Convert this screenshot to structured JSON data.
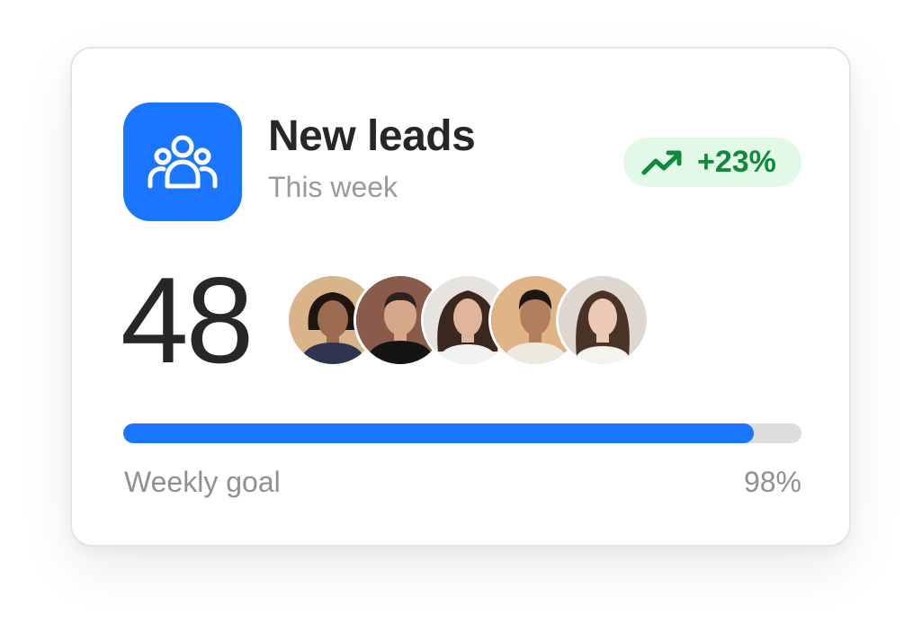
{
  "card": {
    "title": "New leads",
    "subtitle": "This week",
    "icon": "users-group-icon",
    "accent_color": "#1a75ff"
  },
  "trend_badge": {
    "icon": "trending-up-icon",
    "label": "+23%",
    "color": "#0f8a3c",
    "background": "#e3f9e8"
  },
  "lead_count": "48",
  "avatars": [
    {
      "name": "avatar-1",
      "bg": "#d9b48a",
      "skin": "#9c6a4e",
      "hair": "#1e1410",
      "shirt": "#2e3550"
    },
    {
      "name": "avatar-2",
      "bg": "#8a5a4a",
      "skin": "#d7a78a",
      "hair": "#2a2320",
      "shirt": "#141414"
    },
    {
      "name": "avatar-3",
      "bg": "#e7e3de",
      "skin": "#e0b59c",
      "hair": "#3a281e",
      "shirt": "#f2f2f2"
    },
    {
      "name": "avatar-4",
      "bg": "#e0b487",
      "skin": "#b07d5d",
      "hair": "#1c1512",
      "shirt": "#ece8e2"
    },
    {
      "name": "avatar-5",
      "bg": "#ded7cf",
      "skin": "#ecc9b5",
      "hair": "#4a3326",
      "shirt": "#f6f3ef"
    }
  ],
  "progress": {
    "label": "Weekly goal",
    "value_text": "98%",
    "fill_fraction": 0.93
  }
}
